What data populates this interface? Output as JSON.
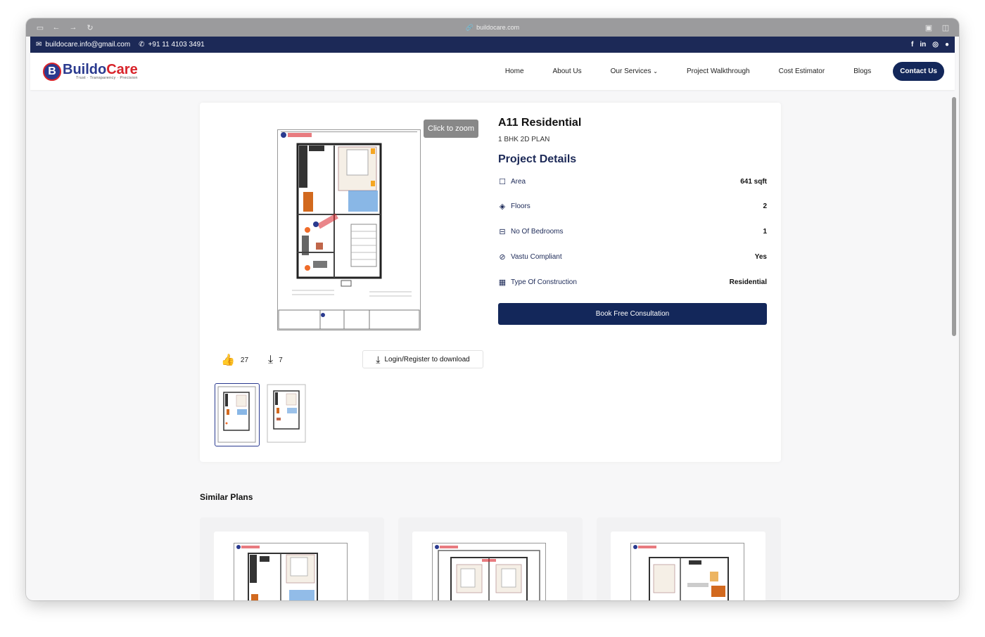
{
  "browser": {
    "url": "buildocare.com"
  },
  "topbar": {
    "email": "buildocare.info@gmail.com",
    "phone": "+91 11 4103 3491",
    "socials": [
      "facebook-icon",
      "linkedin-icon",
      "instagram-icon",
      "whatsapp-icon"
    ]
  },
  "logo": {
    "name_part1": "Buildo",
    "name_part2": "Care",
    "tagline": "Trust · Transparency · Precision",
    "mark": "B"
  },
  "nav": {
    "items": [
      "Home",
      "About Us",
      "Our Services",
      "Project Walkthrough",
      "Cost Estimator",
      "Blogs"
    ],
    "contact": "Contact Us"
  },
  "viewer": {
    "zoom_label": "Click to zoom",
    "likes": "27",
    "downloads": "7",
    "download_button": "Login/Register to download"
  },
  "project": {
    "title": "A11 Residential",
    "subtitle": "1 BHK 2D PLAN",
    "details_heading": "Project Details",
    "details": [
      {
        "icon": "square-icon",
        "label": "Area",
        "value": "641 sqft"
      },
      {
        "icon": "layers-icon",
        "label": "Floors",
        "value": "2"
      },
      {
        "icon": "bed-icon",
        "label": "No Of Bedrooms",
        "value": "1"
      },
      {
        "icon": "compass-icon",
        "label": "Vastu Compliant",
        "value": "Yes"
      },
      {
        "icon": "building-icon",
        "label": "Type Of Construction",
        "value": "Residential"
      }
    ],
    "cta": "Book Free Consultation"
  },
  "similar": {
    "heading": "Similar Plans"
  },
  "colors": {
    "navy": "#13275a",
    "brand_blue": "#2a3a8f",
    "brand_red": "#d8232a"
  }
}
